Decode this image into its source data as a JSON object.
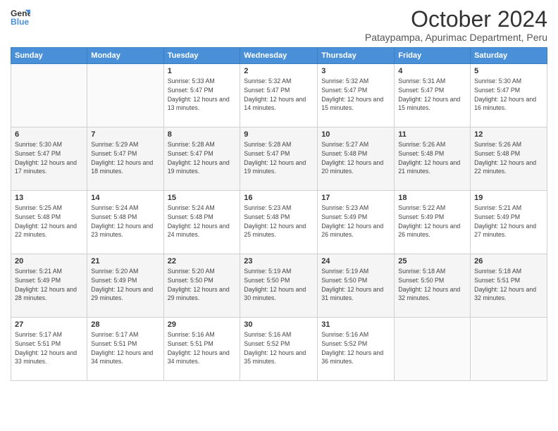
{
  "logo": {
    "line1": "General",
    "line2": "Blue"
  },
  "title": "October 2024",
  "subtitle": "Pataypampa, Apurimac Department, Peru",
  "days_of_week": [
    "Sunday",
    "Monday",
    "Tuesday",
    "Wednesday",
    "Thursday",
    "Friday",
    "Saturday"
  ],
  "weeks": [
    [
      {
        "day": "",
        "sunrise": "",
        "sunset": "",
        "daylight": ""
      },
      {
        "day": "",
        "sunrise": "",
        "sunset": "",
        "daylight": ""
      },
      {
        "day": "1",
        "sunrise": "Sunrise: 5:33 AM",
        "sunset": "Sunset: 5:47 PM",
        "daylight": "Daylight: 12 hours and 13 minutes."
      },
      {
        "day": "2",
        "sunrise": "Sunrise: 5:32 AM",
        "sunset": "Sunset: 5:47 PM",
        "daylight": "Daylight: 12 hours and 14 minutes."
      },
      {
        "day": "3",
        "sunrise": "Sunrise: 5:32 AM",
        "sunset": "Sunset: 5:47 PM",
        "daylight": "Daylight: 12 hours and 15 minutes."
      },
      {
        "day": "4",
        "sunrise": "Sunrise: 5:31 AM",
        "sunset": "Sunset: 5:47 PM",
        "daylight": "Daylight: 12 hours and 15 minutes."
      },
      {
        "day": "5",
        "sunrise": "Sunrise: 5:30 AM",
        "sunset": "Sunset: 5:47 PM",
        "daylight": "Daylight: 12 hours and 16 minutes."
      }
    ],
    [
      {
        "day": "6",
        "sunrise": "Sunrise: 5:30 AM",
        "sunset": "Sunset: 5:47 PM",
        "daylight": "Daylight: 12 hours and 17 minutes."
      },
      {
        "day": "7",
        "sunrise": "Sunrise: 5:29 AM",
        "sunset": "Sunset: 5:47 PM",
        "daylight": "Daylight: 12 hours and 18 minutes."
      },
      {
        "day": "8",
        "sunrise": "Sunrise: 5:28 AM",
        "sunset": "Sunset: 5:47 PM",
        "daylight": "Daylight: 12 hours and 19 minutes."
      },
      {
        "day": "9",
        "sunrise": "Sunrise: 5:28 AM",
        "sunset": "Sunset: 5:47 PM",
        "daylight": "Daylight: 12 hours and 19 minutes."
      },
      {
        "day": "10",
        "sunrise": "Sunrise: 5:27 AM",
        "sunset": "Sunset: 5:48 PM",
        "daylight": "Daylight: 12 hours and 20 minutes."
      },
      {
        "day": "11",
        "sunrise": "Sunrise: 5:26 AM",
        "sunset": "Sunset: 5:48 PM",
        "daylight": "Daylight: 12 hours and 21 minutes."
      },
      {
        "day": "12",
        "sunrise": "Sunrise: 5:26 AM",
        "sunset": "Sunset: 5:48 PM",
        "daylight": "Daylight: 12 hours and 22 minutes."
      }
    ],
    [
      {
        "day": "13",
        "sunrise": "Sunrise: 5:25 AM",
        "sunset": "Sunset: 5:48 PM",
        "daylight": "Daylight: 12 hours and 22 minutes."
      },
      {
        "day": "14",
        "sunrise": "Sunrise: 5:24 AM",
        "sunset": "Sunset: 5:48 PM",
        "daylight": "Daylight: 12 hours and 23 minutes."
      },
      {
        "day": "15",
        "sunrise": "Sunrise: 5:24 AM",
        "sunset": "Sunset: 5:48 PM",
        "daylight": "Daylight: 12 hours and 24 minutes."
      },
      {
        "day": "16",
        "sunrise": "Sunrise: 5:23 AM",
        "sunset": "Sunset: 5:48 PM",
        "daylight": "Daylight: 12 hours and 25 minutes."
      },
      {
        "day": "17",
        "sunrise": "Sunrise: 5:23 AM",
        "sunset": "Sunset: 5:49 PM",
        "daylight": "Daylight: 12 hours and 26 minutes."
      },
      {
        "day": "18",
        "sunrise": "Sunrise: 5:22 AM",
        "sunset": "Sunset: 5:49 PM",
        "daylight": "Daylight: 12 hours and 26 minutes."
      },
      {
        "day": "19",
        "sunrise": "Sunrise: 5:21 AM",
        "sunset": "Sunset: 5:49 PM",
        "daylight": "Daylight: 12 hours and 27 minutes."
      }
    ],
    [
      {
        "day": "20",
        "sunrise": "Sunrise: 5:21 AM",
        "sunset": "Sunset: 5:49 PM",
        "daylight": "Daylight: 12 hours and 28 minutes."
      },
      {
        "day": "21",
        "sunrise": "Sunrise: 5:20 AM",
        "sunset": "Sunset: 5:49 PM",
        "daylight": "Daylight: 12 hours and 29 minutes."
      },
      {
        "day": "22",
        "sunrise": "Sunrise: 5:20 AM",
        "sunset": "Sunset: 5:50 PM",
        "daylight": "Daylight: 12 hours and 29 minutes."
      },
      {
        "day": "23",
        "sunrise": "Sunrise: 5:19 AM",
        "sunset": "Sunset: 5:50 PM",
        "daylight": "Daylight: 12 hours and 30 minutes."
      },
      {
        "day": "24",
        "sunrise": "Sunrise: 5:19 AM",
        "sunset": "Sunset: 5:50 PM",
        "daylight": "Daylight: 12 hours and 31 minutes."
      },
      {
        "day": "25",
        "sunrise": "Sunrise: 5:18 AM",
        "sunset": "Sunset: 5:50 PM",
        "daylight": "Daylight: 12 hours and 32 minutes."
      },
      {
        "day": "26",
        "sunrise": "Sunrise: 5:18 AM",
        "sunset": "Sunset: 5:51 PM",
        "daylight": "Daylight: 12 hours and 32 minutes."
      }
    ],
    [
      {
        "day": "27",
        "sunrise": "Sunrise: 5:17 AM",
        "sunset": "Sunset: 5:51 PM",
        "daylight": "Daylight: 12 hours and 33 minutes."
      },
      {
        "day": "28",
        "sunrise": "Sunrise: 5:17 AM",
        "sunset": "Sunset: 5:51 PM",
        "daylight": "Daylight: 12 hours and 34 minutes."
      },
      {
        "day": "29",
        "sunrise": "Sunrise: 5:16 AM",
        "sunset": "Sunset: 5:51 PM",
        "daylight": "Daylight: 12 hours and 34 minutes."
      },
      {
        "day": "30",
        "sunrise": "Sunrise: 5:16 AM",
        "sunset": "Sunset: 5:52 PM",
        "daylight": "Daylight: 12 hours and 35 minutes."
      },
      {
        "day": "31",
        "sunrise": "Sunrise: 5:16 AM",
        "sunset": "Sunset: 5:52 PM",
        "daylight": "Daylight: 12 hours and 36 minutes."
      },
      {
        "day": "",
        "sunrise": "",
        "sunset": "",
        "daylight": ""
      },
      {
        "day": "",
        "sunrise": "",
        "sunset": "",
        "daylight": ""
      }
    ]
  ]
}
